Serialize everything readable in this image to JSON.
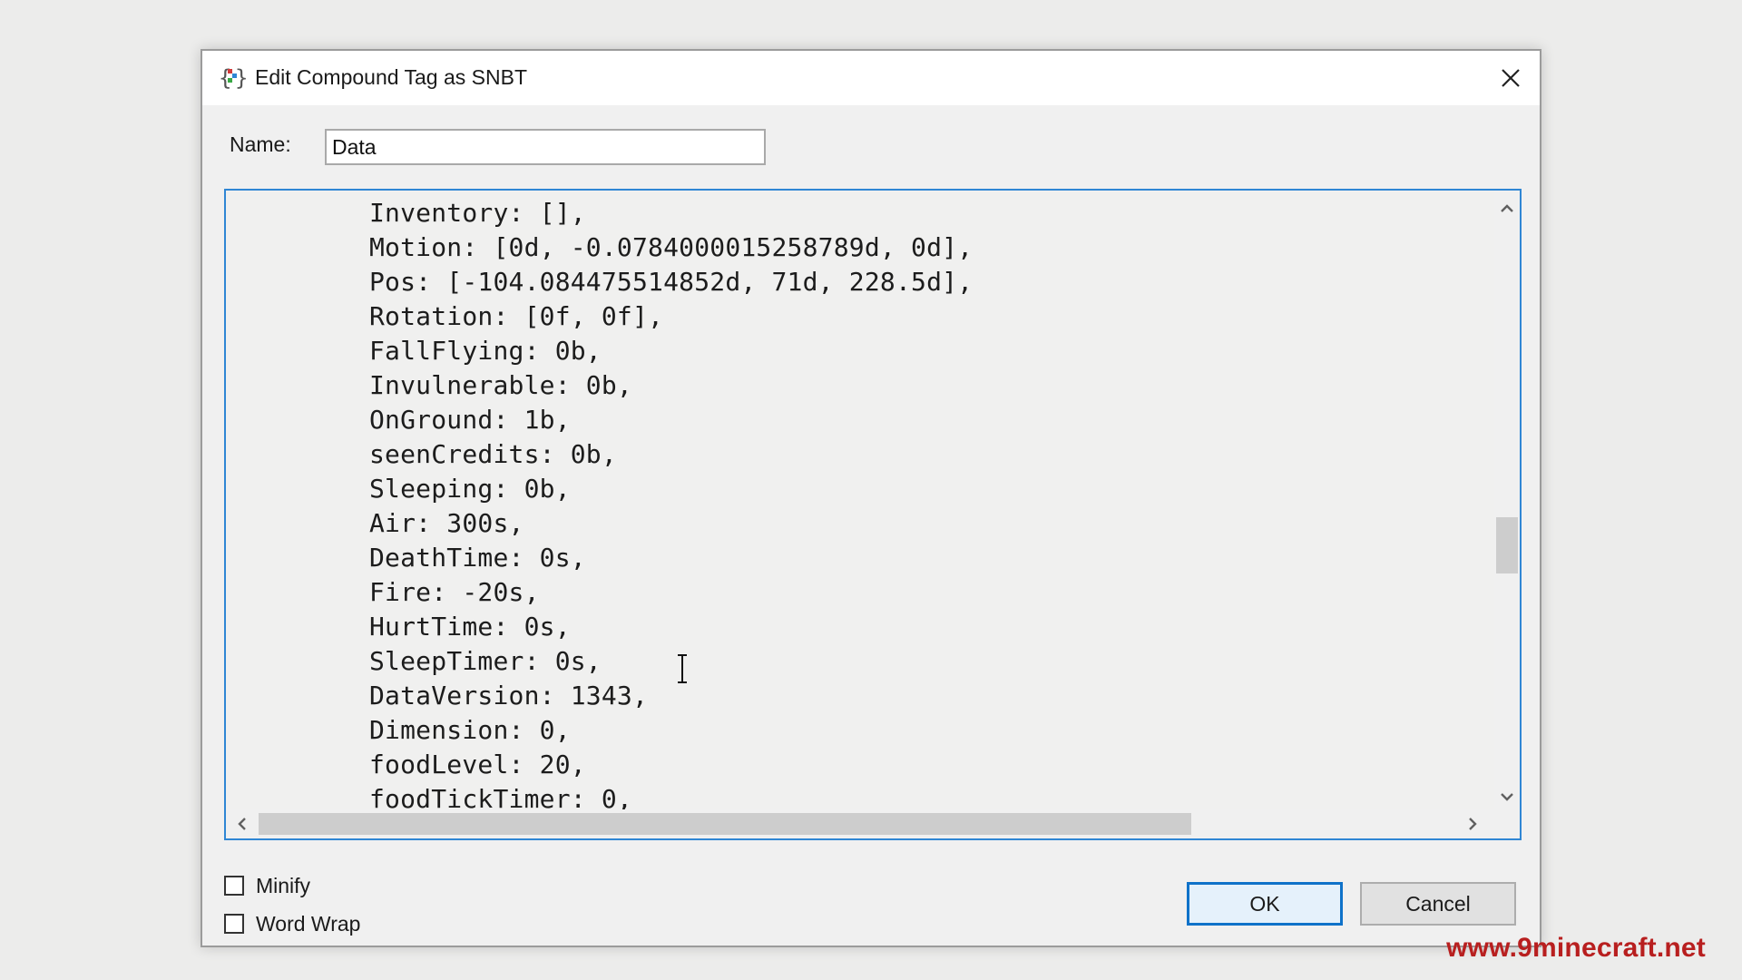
{
  "dialog": {
    "title": "Edit Compound Tag as SNBT",
    "icon": "snbt-compound-icon",
    "close_icon": "close-icon"
  },
  "name_field": {
    "label": "Name:",
    "value": "Data"
  },
  "editor": {
    "lines": [
      "Inventory: [],",
      "Motion: [0d, -0.0784000015258789d, 0d],",
      "Pos: [-104.084475514852d, 71d, 228.5d],",
      "Rotation: [0f, 0f],",
      "FallFlying: 0b,",
      "Invulnerable: 0b,",
      "OnGround: 1b,",
      "seenCredits: 0b,",
      "Sleeping: 0b,",
      "Air: 300s,",
      "DeathTime: 0s,",
      "Fire: -20s,",
      "HurtTime: 0s,",
      "SleepTimer: 0s,",
      "DataVersion: 1343,",
      "Dimension: 0,",
      "foodLevel: 20,",
      "foodTickTimer: 0,"
    ]
  },
  "options": {
    "minify_label": "Minify",
    "minify_checked": false,
    "word_wrap_label": "Word Wrap",
    "word_wrap_checked": false
  },
  "buttons": {
    "ok_label": "OK",
    "cancel_label": "Cancel"
  },
  "watermark": "www.9minecraft.net",
  "colors": {
    "accent": "#0f72c9",
    "editor_border": "#2f86d4",
    "watermark": "#b81f1f"
  }
}
